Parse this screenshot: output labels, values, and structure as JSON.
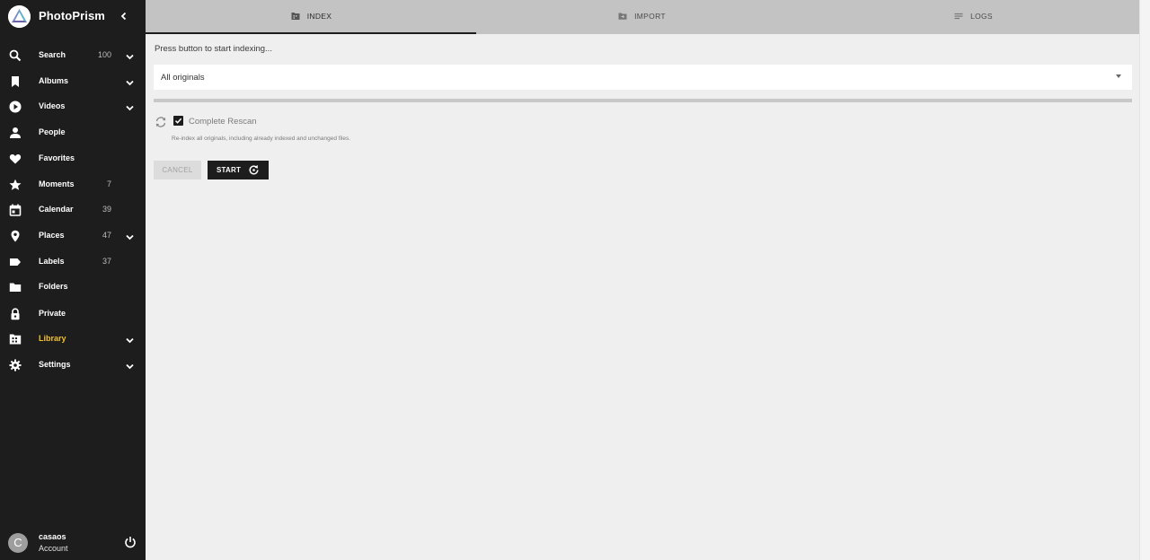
{
  "app": {
    "title": "PhotoPrism"
  },
  "sidebar": {
    "items": [
      {
        "label": "Search",
        "count": "100",
        "icon": "search-icon",
        "expandable": true
      },
      {
        "label": "Albums",
        "count": "",
        "icon": "bookmark-icon",
        "expandable": true
      },
      {
        "label": "Videos",
        "count": "",
        "icon": "play-icon",
        "expandable": true
      },
      {
        "label": "People",
        "count": "",
        "icon": "person-icon",
        "expandable": false
      },
      {
        "label": "Favorites",
        "count": "",
        "icon": "heart-icon",
        "expandable": false
      },
      {
        "label": "Moments",
        "count": "7",
        "icon": "star-icon",
        "expandable": false
      },
      {
        "label": "Calendar",
        "count": "39",
        "icon": "calendar-icon",
        "expandable": false
      },
      {
        "label": "Places",
        "count": "47",
        "icon": "map-pin-icon",
        "expandable": true
      },
      {
        "label": "Labels",
        "count": "37",
        "icon": "label-icon",
        "expandable": false
      },
      {
        "label": "Folders",
        "count": "",
        "icon": "folder-icon",
        "expandable": false
      },
      {
        "label": "Private",
        "count": "",
        "icon": "lock-icon",
        "expandable": false
      },
      {
        "label": "Library",
        "count": "",
        "icon": "library-icon",
        "expandable": true,
        "active": true
      },
      {
        "label": "Settings",
        "count": "",
        "icon": "gear-icon",
        "expandable": true
      }
    ],
    "account": {
      "initial": "C",
      "name": "casaos",
      "subtitle": "Account"
    }
  },
  "tabs": [
    {
      "label": "INDEX",
      "icon": "library-icon",
      "active": true
    },
    {
      "label": "IMPORT",
      "icon": "folder-import-icon",
      "active": false
    },
    {
      "label": "LOGS",
      "icon": "logs-icon",
      "active": false
    }
  ],
  "index": {
    "hint": "Press button to start indexing...",
    "path_select": {
      "value": "All originals"
    },
    "progress_percent": 0,
    "complete_rescan": {
      "label": "Complete Rescan",
      "checked": true,
      "help": "Re-index all originals, including already indexed and unchanged files."
    },
    "cancel_label": "CANCEL",
    "start_label": "START"
  },
  "colors": {
    "sidebar_bg": "#1d1d1d",
    "active_accent": "#f2c12e",
    "tabbar_bg": "#c3c3c3",
    "content_bg": "#efefef"
  }
}
